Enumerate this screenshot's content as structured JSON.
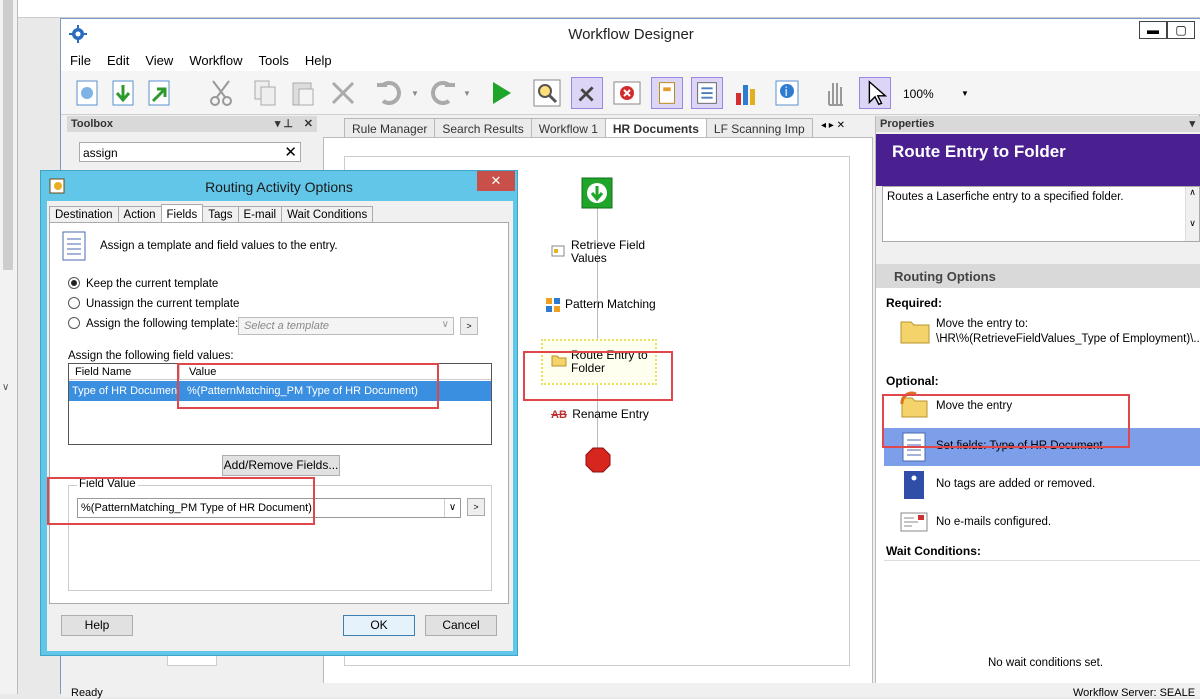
{
  "window": {
    "title": "Workflow Designer"
  },
  "menu": [
    "File",
    "Edit",
    "View",
    "Workflow",
    "Tools",
    "Help"
  ],
  "toolbar": {
    "zoom": "100%"
  },
  "toolbox": {
    "header": "Toolbox",
    "search_value": "assign"
  },
  "tabs": [
    "Rule Manager",
    "Search Results",
    "Workflow 1",
    "HR Documents",
    "LF Scanning Imp"
  ],
  "workflow": {
    "items": [
      "Retrieve Field Values",
      "Pattern Matching",
      "Route Entry to Folder",
      "Rename Entry"
    ]
  },
  "properties": {
    "header": "Properties",
    "title": "Route Entry to Folder",
    "description": "Routes a Laserfiche entry to a specified folder.",
    "section": "Routing Options",
    "required_label": "Required:",
    "move_to_label": "Move the entry to:",
    "move_to_path": "\\HR\\%(RetrieveFieldValues_Type of Employment)\\...",
    "optional_label": "Optional:",
    "move_entry": "Move the entry",
    "set_fields": "Set fields: Type of HR Document",
    "no_tags": "No tags are added or removed.",
    "no_emails": "No e-mails configured.",
    "wait_label": "Wait Conditions:",
    "no_wait": "No wait conditions set."
  },
  "dialog": {
    "title": "Routing Activity Options",
    "tabs": [
      "Destination",
      "Action",
      "Fields",
      "Tags",
      "E-mail",
      "Wait Conditions"
    ],
    "active_tab": "Fields",
    "intro": "Assign a template and field values to the entry.",
    "radio_keep": "Keep the current template",
    "radio_unassign": "Unassign the current template",
    "radio_assign": "Assign the following template:",
    "template_placeholder": "Select a template",
    "assign_fields_label": "Assign the following field values:",
    "grid_headers": [
      "Field Name",
      "Value"
    ],
    "grid_rows": [
      {
        "field": "Type of HR Document",
        "value": "%(PatternMatching_PM Type of HR Document)"
      }
    ],
    "add_remove": "Add/Remove Fields...",
    "field_value_label": "Field Value",
    "field_value": "%(PatternMatching_PM Type of HR Document)",
    "help": "Help",
    "ok": "OK",
    "cancel": "Cancel"
  },
  "status": {
    "left": "Ready",
    "right": "Workflow Server: SEALE"
  }
}
